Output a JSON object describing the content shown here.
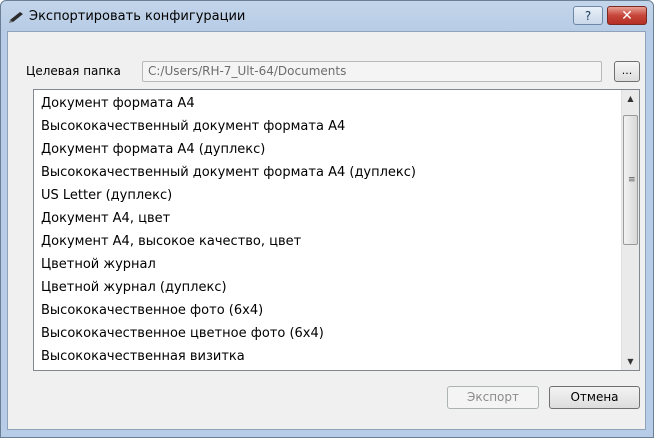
{
  "window": {
    "title": "Экспортировать конфигурации",
    "help_label": "?",
    "close_label": "✕"
  },
  "folder": {
    "label": "Целевая папка",
    "value": "C:/Users/RH-7_Ult-64/Documents",
    "browse_label": "..."
  },
  "list": {
    "items": [
      "Документ формата А4",
      "Высококачественный документ формата А4",
      "Документ формата А4 (дуплекс)",
      "Высококачественный документ формата А4 (дуплекс)",
      "US Letter (дуплекс)",
      "Документ А4, цвет",
      "Документ А4, высокое качество, цвет",
      "Цветной журнал",
      "Цветной журнал (дуплекс)",
      "Высококачественное фото (6x4)",
      "Высококачественное цветное фото (6x4)",
      "Высококачественная визитка"
    ],
    "scroll_up": "▲",
    "scroll_down": "▼",
    "thumb_grip": "≡"
  },
  "buttons": {
    "export_label": "Экспорт",
    "cancel_label": "Отмена"
  },
  "icons": {
    "title_icon": "pen-icon"
  }
}
